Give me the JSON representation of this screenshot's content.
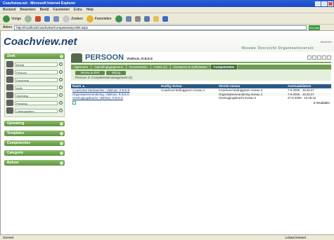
{
  "window": {
    "title": "Coachview.net - Microsoft Internet Explorer"
  },
  "menu": [
    "Bestand",
    "Bewerken",
    "Beeld",
    "Favorieten",
    "Extra",
    "Help"
  ],
  "toolbar": {
    "back": "Vorige",
    "search": "Zoeken",
    "favorites": "Favorieten"
  },
  "address": {
    "label": "Adres",
    "value": "http://localhost/Coachview/Competentieprofiel.aspx",
    "go": "Ga naar"
  },
  "brand": {
    "logo": "Coachview.net",
    "tagline": "Nieuwe Overzicht Organisatieversie",
    "user_link": "afmelden"
  },
  "sidebar": {
    "zoek": "Zoek",
    "search_rows": [
      {
        "value": "Bedrijf"
      },
      {
        "value": "Persoon"
      },
      {
        "value": "Document"
      },
      {
        "value": "Actie"
      },
      {
        "value": "Opleiding"
      },
      {
        "value": "Planning"
      },
      {
        "value": "Catalogusitem"
      }
    ],
    "groups": [
      "Opmaking",
      "Templates",
      "Competenties",
      "Categorie",
      "Beheer"
    ]
  },
  "persoon": {
    "title": "PERSOON",
    "name": "Vlakhuis, R.B.E.E"
  },
  "tabs": [
    "Algemeen",
    "Opleidingsgegevens",
    "Documenten",
    "Acties (1)",
    "Vacatures & Sollicitaties",
    "Competenties"
  ],
  "subbar": {
    "btn_new": "Nieuw profiel",
    "btn_open": "Wijzig",
    "crumb": "Persoon in Competentiemanagement (1)"
  },
  "grid": {
    "headers": [
      "Naam ▲",
      "Huidig niveau",
      "Vereist niveau",
      "Aanmaakdatum"
    ],
    "rows": [
      [
        "Coachview Medewerker, Vlakhuis, R.B.E.E",
        "Coachend leidinggeven niveau 2",
        "Coachend leidinggeven niveau 2",
        "7-6-2006 - 15:26:27"
      ],
      [
        "Organisatieverandering, Vlakhuis, R.B.E.E",
        "",
        "Organisatieverandering niveau 3",
        "7-6-2006 - 15:26:27"
      ],
      [
        "Overtuigingskracht, Vlakhuis, R.B.E.E",
        "",
        "Overtuigingskracht niveau 2",
        "27-6-2006 - 10:29:10"
      ]
    ],
    "footer": "3 resultaten"
  },
  "status": {
    "left": "Gereed",
    "zone": "Lokaal intranet"
  }
}
